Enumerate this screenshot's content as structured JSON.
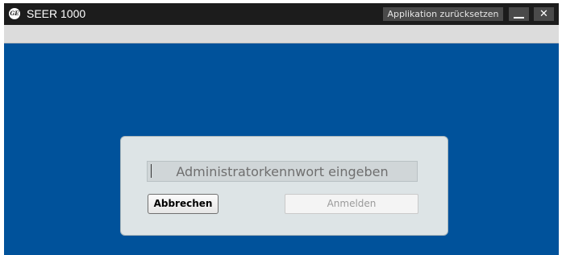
{
  "titlebar": {
    "logo_text": "GE",
    "title": "SEER 1000",
    "reset_label": "Applikation zurücksetzen",
    "minimize_glyph": "",
    "close_glyph": "✕"
  },
  "dialog": {
    "password_placeholder": "Administratorkennwort eingeben",
    "cancel_label": "Abbrechen",
    "login_label": "Anmelden"
  },
  "icons": {
    "logo": "ge-logo-icon",
    "minimize": "minimize-icon",
    "close": "close-icon"
  },
  "colors": {
    "background": "#00529b",
    "titlebar": "#1c1c1c",
    "dialog": "#dde4e6"
  }
}
